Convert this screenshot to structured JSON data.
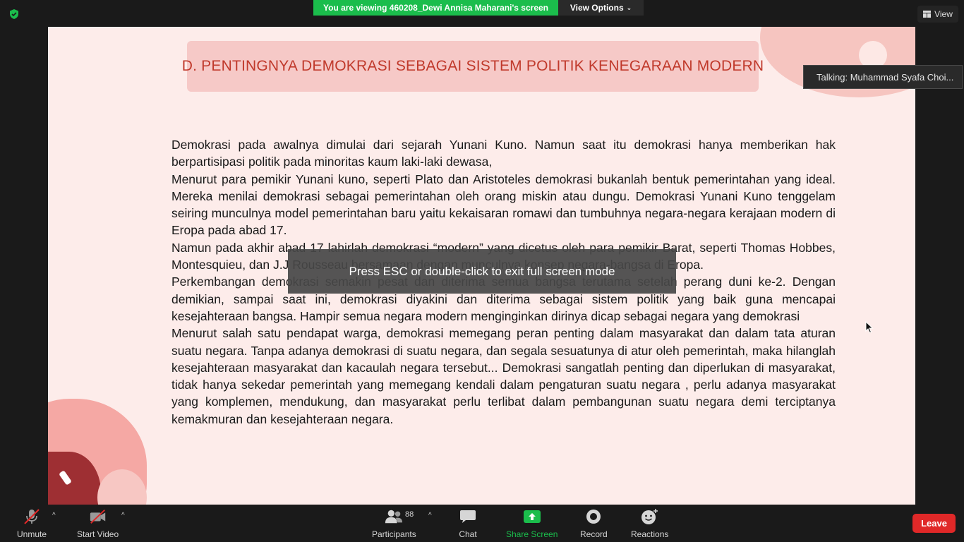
{
  "header": {
    "viewing_banner": "You are viewing 460208_Dewi Annisa Maharani's screen",
    "view_options_label": "View Options",
    "view_button_label": "View",
    "security_icon": "shield-check-icon"
  },
  "slide": {
    "title": "D. PENTINGNYA DEMOKRASI SEBAGAI SISTEM POLITIK KENEGARAAN MODERN",
    "paragraphs": [
      "Demokrasi pada awalnya dimulai dari sejarah Yunani Kuno. Namun saat itu demokrasi hanya memberikan hak berpartisipasi politik pada minoritas kaum laki-laki dewasa,",
      "Menurut para pemikir Yunani kuno, seperti Plato dan Aristoteles demokrasi bukanlah bentuk pemerintahan yang ideal. Mereka menilai demokrasi sebagai pemerintahan oleh orang miskin atau dungu. Demokrasi Yunani Kuno tenggelam seiring munculnya model pemerintahan baru yaitu kekaisaran romawi dan tumbuhnya negara-negara kerajaan modern di Eropa pada abad 17.",
      "Namun pada akhir abad 17 lahirlah demokrasi “modern” yang dicetus oleh para pemikir Barat, seperti Thomas Hobbes, Montesquieu, dan J.J Rousseau bersamaan dengan munculnya konsep negara-bangsa di Eropa.",
      "Perkembangan demokrasi semakin pesat dan diterima semua bangsa terutama setelah perang duni ke-2. Dengan demikian, sampai saat ini, demokrasi diyakini dan diterima sebagai sistem politik yang baik guna mencapai kesejahteraan bangsa. Hampir semua negara modern menginginkan dirinya dicap sebagai negara yang demokrasi",
      "Menurut salah satu pendapat warga, demokrasi memegang peran penting dalam masyarakat dan dalam tata aturan suatu negara. Tanpa adanya demokrasi di suatu negara, dan segala sesuatunya di atur oleh pemerintah, maka hilanglah kesejahteraan masyarakat dan kacaulah negara tersebut... Demokrasi sangatlah penting dan diperlukan di masyarakat, tidak hanya sekedar pemerintah yang memegang kendali dalam pengaturan suatu negara , perlu adanya masyarakat yang komplemen, mendukung, dan masyarakat perlu terlibat dalam pembangunan suatu negara demi terciptanya kemakmuran dan kesejahteraan negara."
    ]
  },
  "talking_indicator": "Talking: Muhammad Syafa Choi...",
  "esc_overlay": "Press ESC or double-click to exit full screen mode",
  "toolbar": {
    "unmute_label": "Unmute",
    "start_video_label": "Start Video",
    "participants_label": "Participants",
    "participants_count": "88",
    "chat_label": "Chat",
    "share_screen_label": "Share Screen",
    "record_label": "Record",
    "reactions_label": "Reactions",
    "leave_label": "Leave"
  },
  "colors": {
    "banner_green": "#1bbd4c",
    "leave_red": "#e02828",
    "title_red": "#c0392b",
    "slide_bg": "#fdecea"
  }
}
